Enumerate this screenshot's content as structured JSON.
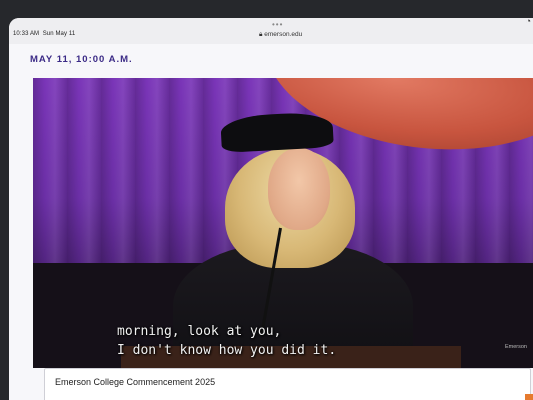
{
  "status_bar": {
    "time": "10:33 AM",
    "date": "Sun May 11",
    "url": "emerson.edu",
    "dots": "•••",
    "wifi_icon": "wifi-icon"
  },
  "page": {
    "dateline": "MAY 11, 10:00 A.M."
  },
  "video": {
    "caption_lines": [
      "morning, look at you,",
      "I don't know how you did it."
    ],
    "watermark": "Emerson"
  },
  "card": {
    "title": "Emerson College Commencement 2025"
  },
  "colors": {
    "accent": "#3b2a86",
    "curtain": "#6b2fa6",
    "banner": "#c8553f"
  }
}
